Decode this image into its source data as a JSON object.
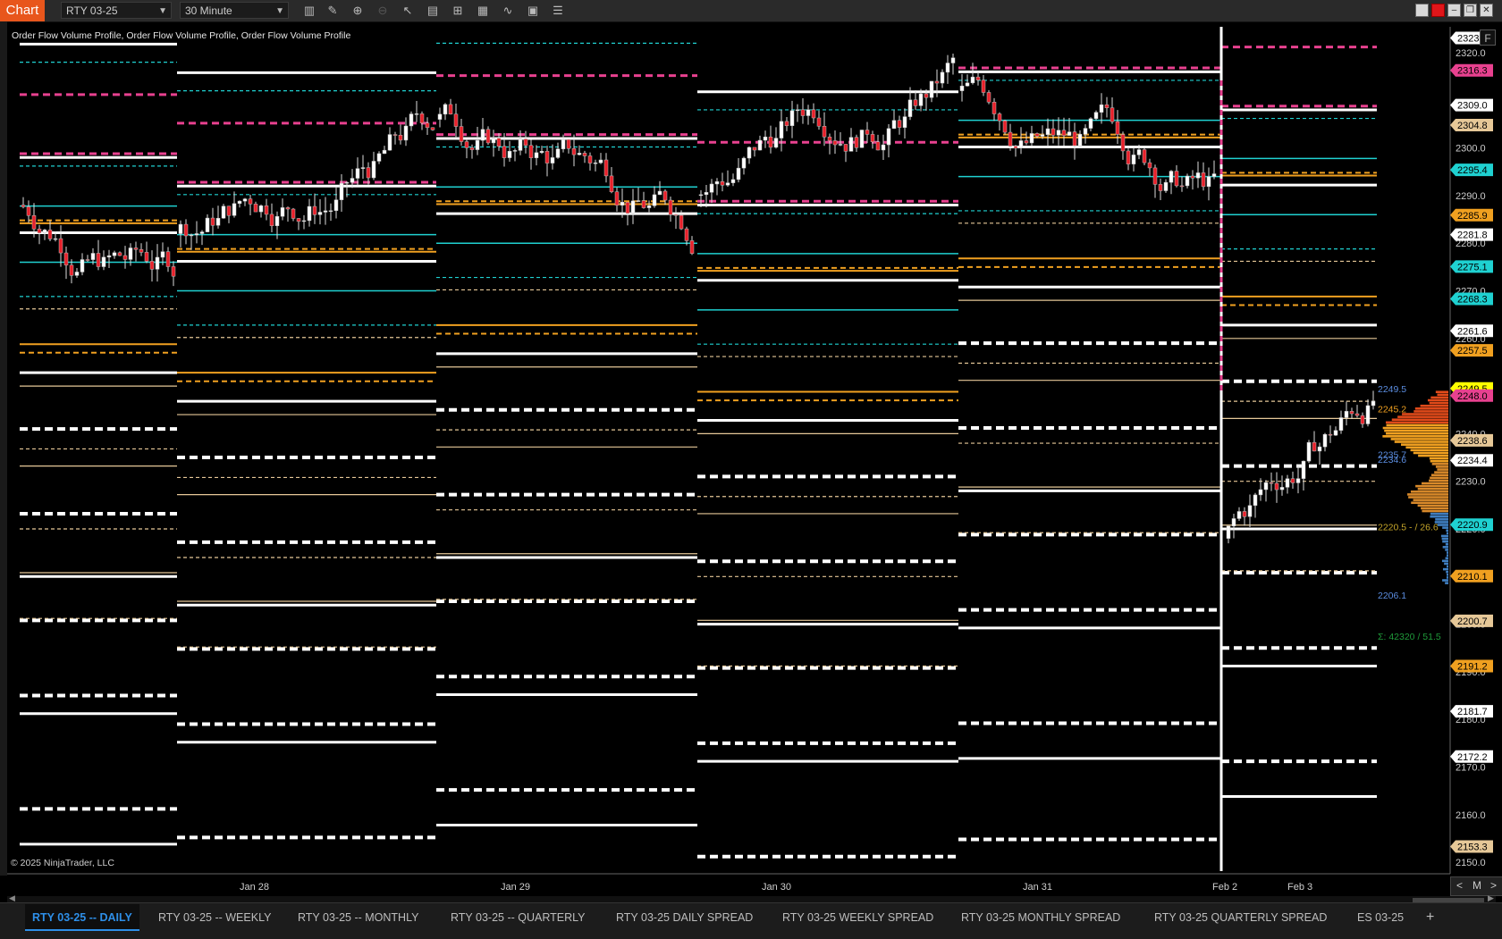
{
  "window": {
    "app_label": "Chart"
  },
  "toolbar": {
    "instrument": "RTY 03-25",
    "interval": "30 Minute",
    "icons": [
      "bar-type-icon",
      "draw-tool-icon",
      "zoom-in-icon",
      "zoom-out-icon",
      "pointer-icon",
      "data-box-icon",
      "template-icon",
      "strategies-icon",
      "indicators-icon",
      "properties-icon",
      "chart-trader-icon"
    ]
  },
  "chart": {
    "indicator_label": "Order Flow Volume Profile, Order Flow Volume Profile, Order Flow Volume Profile",
    "copyright": "© 2025 NinjaTrader, LLC",
    "f_button": "F",
    "x_labels": [
      "Jan 28",
      "Jan 29",
      "Jan 30",
      "Jan 31",
      "Feb 2",
      "Feb 3"
    ],
    "axis_ticks": [
      "2320.0",
      "2300.0",
      "2290.0",
      "2280.0",
      "2270.0",
      "2260.0",
      "2250.0",
      "2240.0",
      "2230.0",
      "2220.0",
      "2210.0",
      "2200.0",
      "2190.0",
      "2180.0",
      "2170.0",
      "2160.0",
      "2150.0"
    ],
    "price_flags": [
      {
        "v": "2323.1",
        "bg": "#ffffff",
        "fg": "#000"
      },
      {
        "v": "2316.3",
        "bg": "#e8418f",
        "fg": "#000"
      },
      {
        "v": "2309.0",
        "bg": "#ffffff",
        "fg": "#000"
      },
      {
        "v": "2304.8",
        "bg": "#e6c898",
        "fg": "#000"
      },
      {
        "v": "2295.4",
        "bg": "#1fd1d1",
        "fg": "#000"
      },
      {
        "v": "2285.9",
        "bg": "#f0a020",
        "fg": "#000"
      },
      {
        "v": "2281.8",
        "bg": "#ffffff",
        "fg": "#000"
      },
      {
        "v": "2275.1",
        "bg": "#1fd1d1",
        "fg": "#000"
      },
      {
        "v": "2268.3",
        "bg": "#1fd1d1",
        "fg": "#000"
      },
      {
        "v": "2261.6",
        "bg": "#ffffff",
        "fg": "#000"
      },
      {
        "v": "2257.5",
        "bg": "#f0a020",
        "fg": "#000"
      },
      {
        "v": "2249.5",
        "bg": "#ffff00",
        "fg": "#000"
      },
      {
        "v": "2248.0",
        "bg": "#e8418f",
        "fg": "#000"
      },
      {
        "v": "2238.6",
        "bg": "#e6c898",
        "fg": "#000"
      },
      {
        "v": "2234.4",
        "bg": "#ffffff",
        "fg": "#000"
      },
      {
        "v": "2220.9",
        "bg": "#1fd1d1",
        "fg": "#000"
      },
      {
        "v": "2210.1",
        "bg": "#f0a020",
        "fg": "#000"
      },
      {
        "v": "2200.7",
        "bg": "#e6c898",
        "fg": "#000"
      },
      {
        "v": "2191.2",
        "bg": "#f0a020",
        "fg": "#000"
      },
      {
        "v": "2181.7",
        "bg": "#ffffff",
        "fg": "#000"
      },
      {
        "v": "2172.2",
        "bg": "#ffffff",
        "fg": "#000"
      },
      {
        "v": "2153.3",
        "bg": "#e6c898",
        "fg": "#000"
      }
    ],
    "profile_labels": [
      {
        "t": "2249.5",
        "c": "#5b8de0"
      },
      {
        "t": "2245.2",
        "c": "#f0a020"
      },
      {
        "t": "2235.7",
        "c": "#5b8de0"
      },
      {
        "t": "2234.6",
        "c": "#5b8de0"
      },
      {
        "t": "2220.5 - / 26.6",
        "c": "#c6a62a"
      },
      {
        "t": "2206.1",
        "c": "#5b8de0"
      },
      {
        "t": "Σ: 42320 / 51.5",
        "c": "#1f9a3a"
      }
    ],
    "zoom": {
      "left": "<",
      "mode": "M",
      "right": ">"
    }
  },
  "tabs": [
    {
      "label": "RTY 03-25 -- DAILY",
      "active": true
    },
    {
      "label": "RTY 03-25 -- WEEKLY"
    },
    {
      "label": "RTY 03-25 -- MONTHLY"
    },
    {
      "label": "RTY 03-25 -- QUARTERLY"
    },
    {
      "label": "RTY 03-25 DAILY SPREAD"
    },
    {
      "label": "RTY 03-25 WEEKLY SPREAD"
    },
    {
      "label": "RTY 03-25 MONTHLY SPREAD"
    },
    {
      "label": "RTY 03-25 QUARTERLY SPREAD"
    },
    {
      "label": "ES 03-25"
    }
  ],
  "add_tab": "+",
  "colors": {
    "white": "#ffffff",
    "magenta": "#e8418f",
    "cyan": "#1fd1d1",
    "orange": "#f0a020",
    "tan": "#e6c898",
    "up": "#ffffff",
    "down": "#e8202a"
  }
}
